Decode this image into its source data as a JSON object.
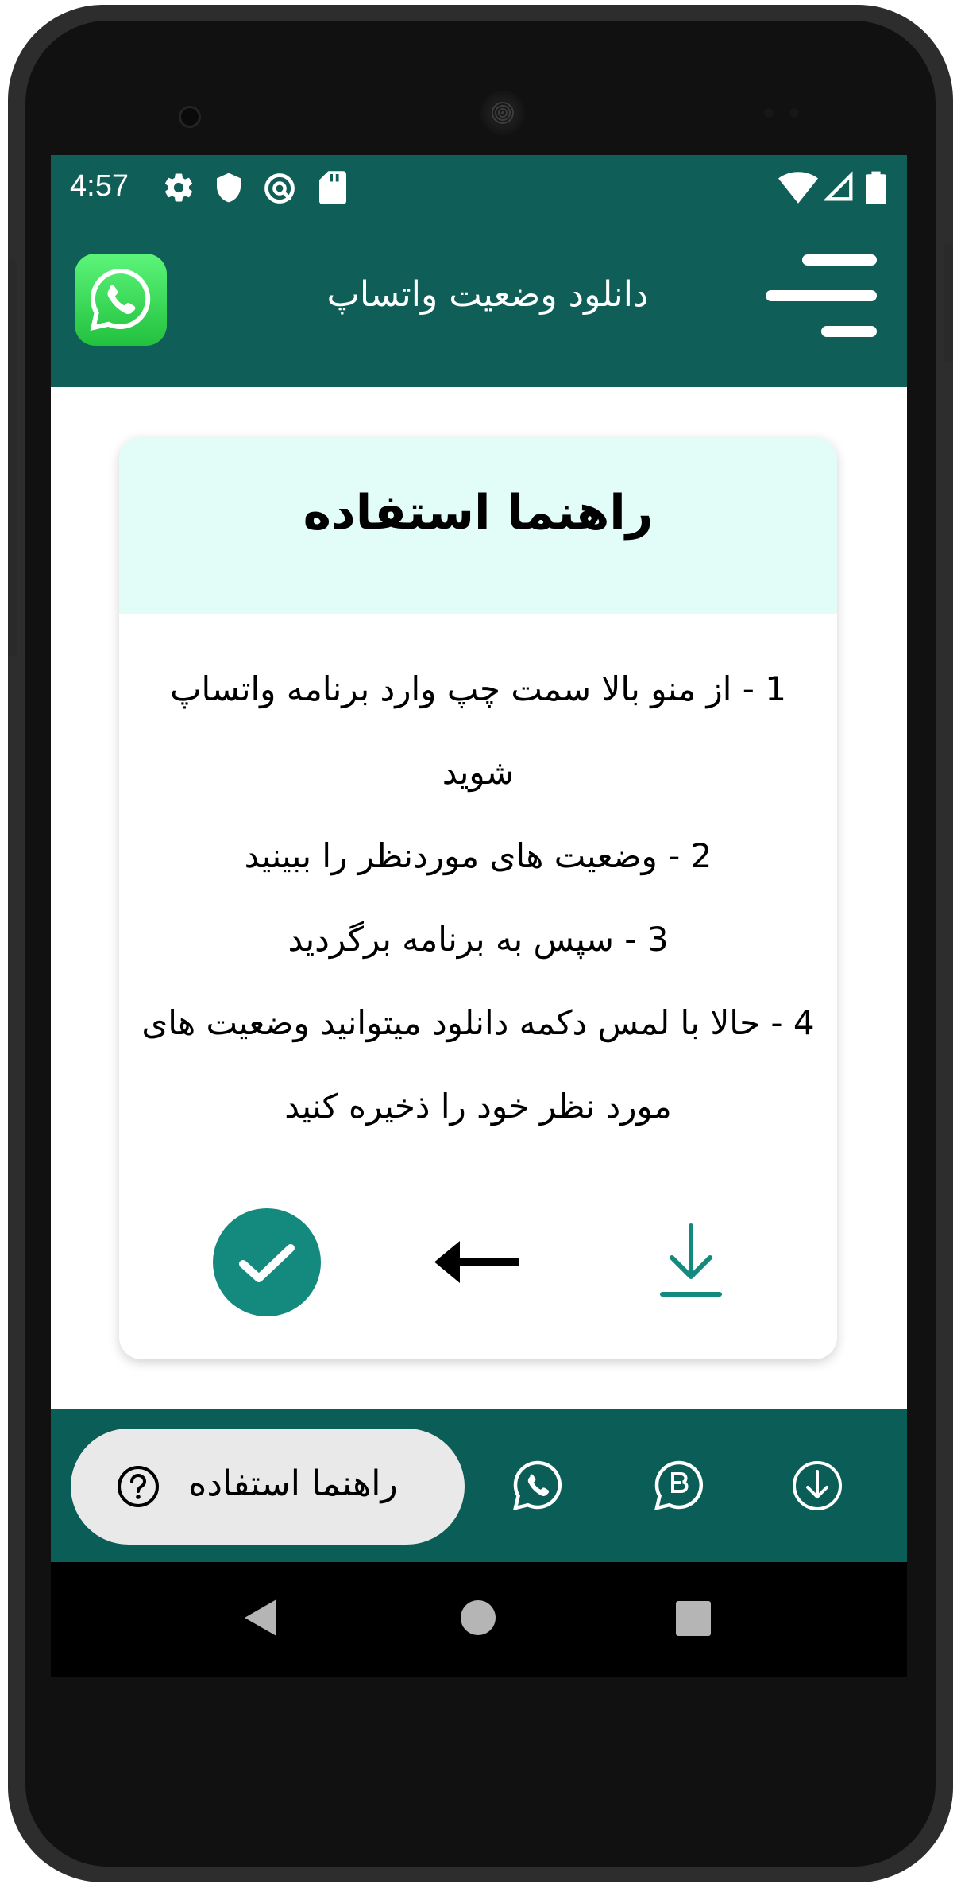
{
  "status_bar": {
    "time": "4:57",
    "left_icons": [
      "gear-icon",
      "shield-icon",
      "vpn-icon",
      "sd-card-icon"
    ],
    "right_icons": [
      "wifi-icon",
      "signal-icon",
      "battery-icon"
    ]
  },
  "app_bar": {
    "title": "دانلود وضعیت واتساپ",
    "logo_icon": "whatsapp-logo-icon",
    "menu_icon": "menu-icon"
  },
  "guide_card": {
    "title": "راهنما استفاده",
    "steps": [
      "1 - از منو بالا سمت چپ وارد برنامه واتساپ شوید",
      "2 - وضعیت های موردنظر را ببینید",
      "3 - سپس به برنامه برگردید",
      "4 - حالا با لمس دکمه دانلود میتوانید وضعیت های مورد نظر خود را ذخیره کنید"
    ],
    "actions": [
      "check-icon",
      "arrow-left-icon",
      "download-icon"
    ]
  },
  "bottom_nav": {
    "active_label": "راهنما استفاده",
    "active_icon": "help-icon",
    "items": [
      "whatsapp-icon",
      "whatsapp-business-icon",
      "download-circle-icon"
    ]
  },
  "system_nav": [
    "back-icon",
    "home-icon",
    "recents-icon"
  ],
  "colors": {
    "primary": "#0f5f58",
    "accent": "#138a7d",
    "card_header": "#e2fcf8",
    "pill": "#e9e9e9"
  }
}
